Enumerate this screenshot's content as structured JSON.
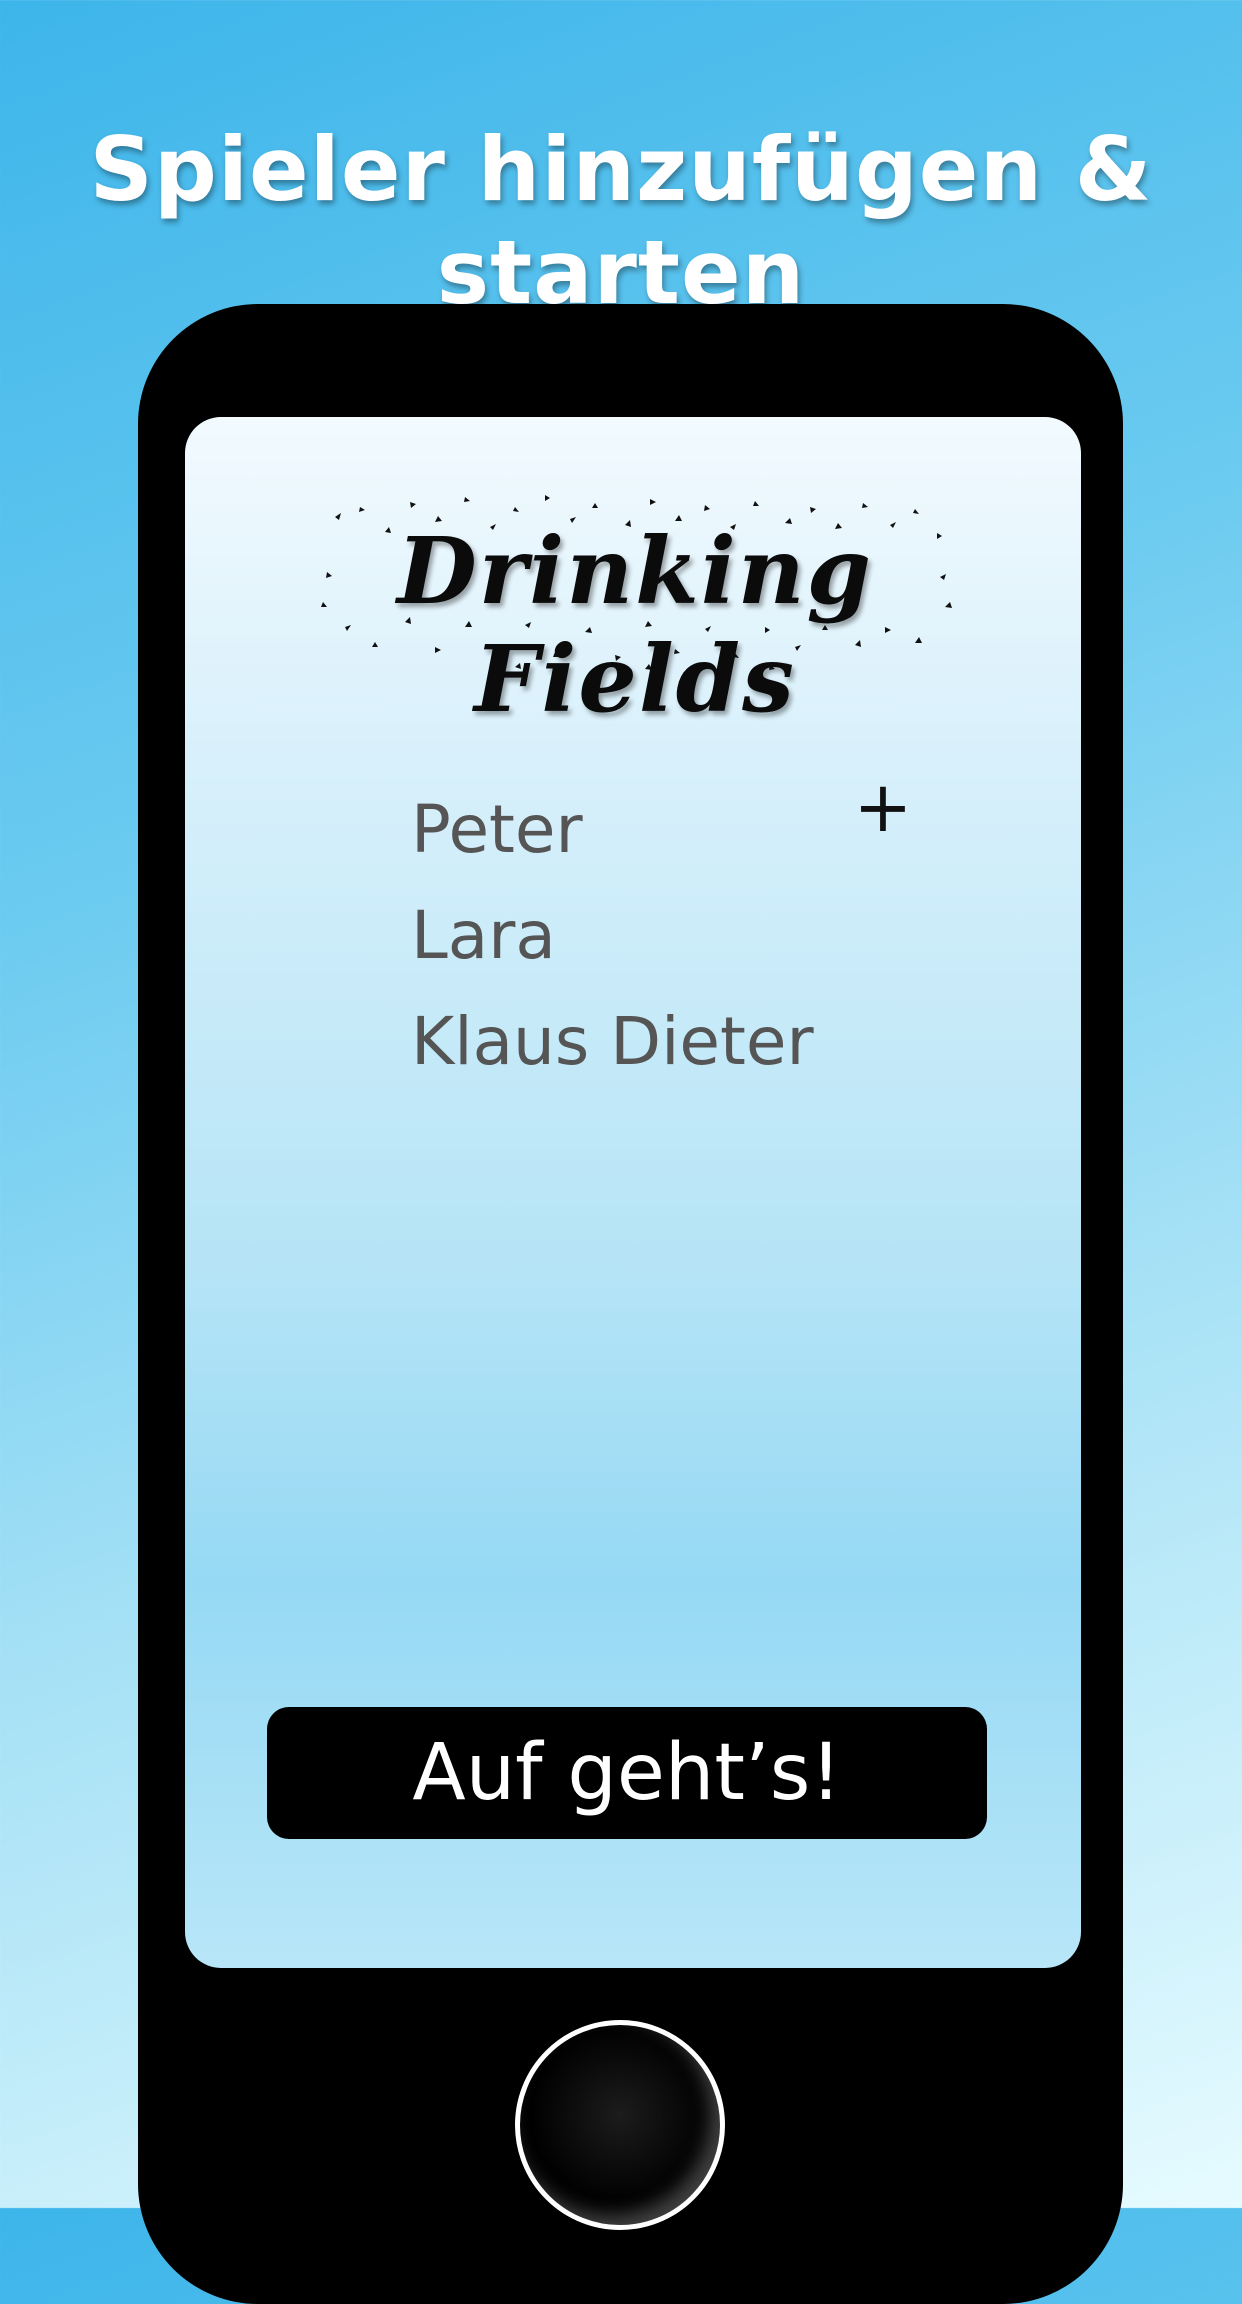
{
  "headline": "Spieler hinzufügen & starten",
  "app": {
    "logo_text": "Drinking Fields"
  },
  "players": [
    {
      "name": "Peter"
    },
    {
      "name": "Lara"
    },
    {
      "name": "Klaus Dieter"
    }
  ],
  "add_button": {
    "label": "+"
  },
  "start_button": {
    "label": "Auf geht’s!"
  },
  "colors": {
    "background_top": "#3db5ea",
    "background_bottom": "#e6fbff",
    "phone_body": "#000000",
    "player_text": "#555555",
    "button_bg": "#000000",
    "button_text": "#ffffff"
  },
  "icons": {
    "add": "plus-icon",
    "home": "home-button-icon"
  }
}
